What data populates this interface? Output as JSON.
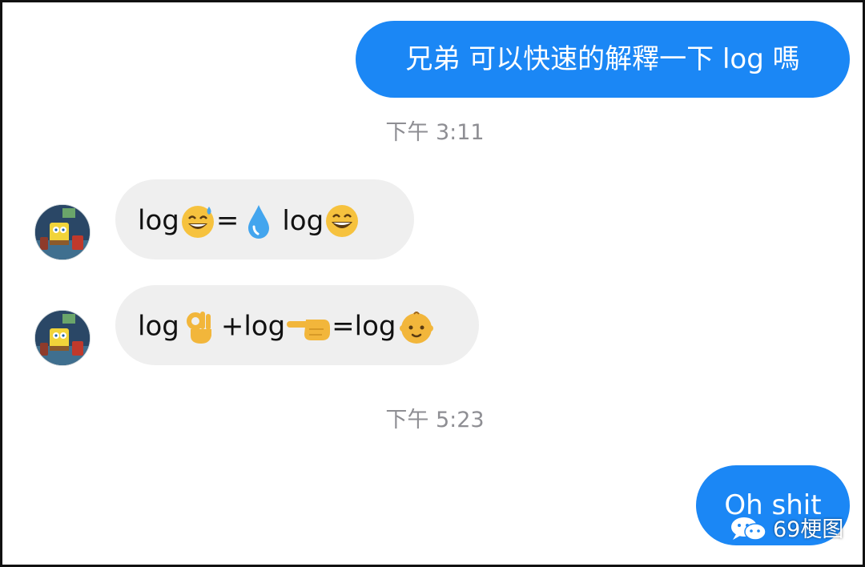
{
  "colors": {
    "outgoing_bubble": "#1b87f5",
    "incoming_bubble": "#efefef",
    "timestamp_text": "#8e8e93"
  },
  "messages": [
    {
      "direction": "outgoing",
      "text": "兄弟 可以快速的解釋一下 log 嗎"
    },
    {
      "direction": "timestamp",
      "text": "下午 3:11"
    },
    {
      "direction": "incoming",
      "parts": [
        "log",
        "grinning-sweat-emoji",
        "=",
        "droplet-emoji",
        " log",
        "grinning-face-emoji"
      ],
      "t1": "log",
      "t2": "=",
      "t3": "log"
    },
    {
      "direction": "incoming",
      "parts": [
        "log",
        "ok-hand-emoji",
        "+log",
        "pointing-left-emoji",
        "=log",
        "baby-emoji"
      ],
      "t1": "log",
      "t2": "+log",
      "t3": "=log"
    },
    {
      "direction": "timestamp",
      "text": "下午 5:23"
    },
    {
      "direction": "outgoing",
      "text": "Oh shit"
    }
  ],
  "avatar": {
    "icon": "spongebob-avatar-icon"
  },
  "watermark": {
    "icon": "wechat-icon",
    "label": "69梗图"
  }
}
